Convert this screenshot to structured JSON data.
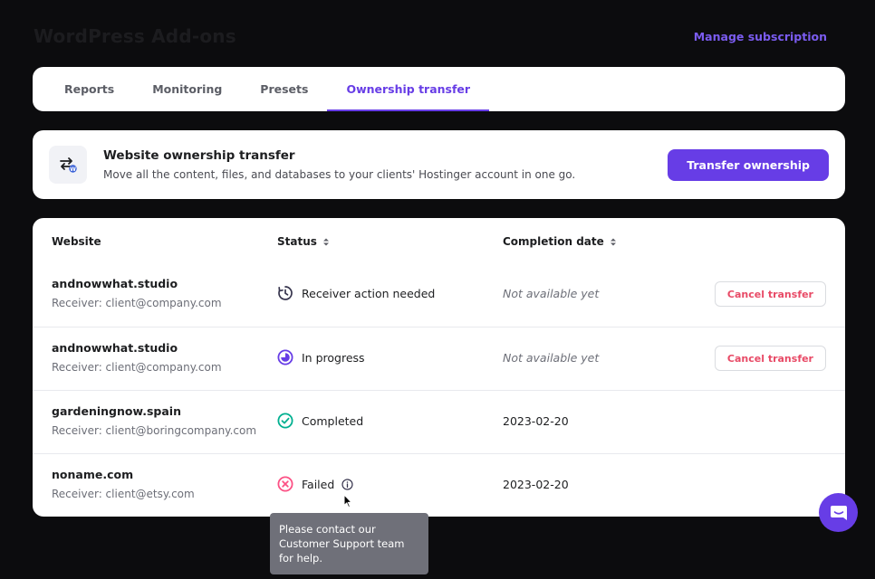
{
  "page": {
    "title": "WordPress Add-ons",
    "manage_link": "Manage subscription"
  },
  "tabs": [
    {
      "label": "Reports",
      "active": false
    },
    {
      "label": "Monitoring",
      "active": false
    },
    {
      "label": "Presets",
      "active": false
    },
    {
      "label": "Ownership transfer",
      "active": true
    }
  ],
  "transfer_card": {
    "icon": "transfer-arrows-wordpress-icon",
    "title": "Website ownership transfer",
    "description": "Move all the content, files, and databases to your clients' Hostinger account in one go.",
    "button_label": "Transfer ownership"
  },
  "table": {
    "headers": {
      "website": "Website",
      "status": "Status",
      "completion_date": "Completion date"
    },
    "rows": [
      {
        "site": "andnowwhat.studio",
        "receiver": "Receiver: client@company.com",
        "status": "Receiver action needed",
        "status_icon": "clock-rotate-icon",
        "date": "Not available yet",
        "action": "Cancel transfer"
      },
      {
        "site": "andnowwhat.studio",
        "receiver": "Receiver: client@company.com",
        "status": "In progress",
        "status_icon": "progress-icon",
        "date": "Not available yet",
        "action": "Cancel transfer"
      },
      {
        "site": "gardeningnow.spain",
        "receiver": "Receiver: client@boringcompany.com",
        "status": "Completed",
        "status_icon": "check-circle-icon",
        "date": "2023-02-20"
      },
      {
        "site": "noname.com",
        "receiver": "Receiver: client@etsy.com",
        "status": "Failed",
        "status_icon": "x-circle-icon",
        "date": "2023-02-20"
      }
    ]
  },
  "tooltip": {
    "text": "Please contact our Customer Support team for help."
  },
  "colors": {
    "accent": "#673de6",
    "success": "#00b090",
    "danger": "#fc5185",
    "cancel_text": "#e84a66",
    "background": "#0c0c0e"
  }
}
